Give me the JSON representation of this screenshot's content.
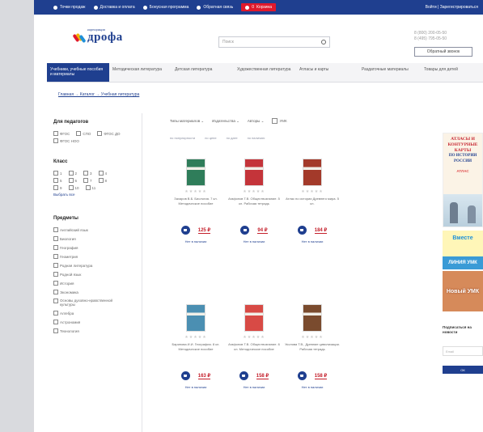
{
  "topbar": {
    "links": [
      {
        "icon": "location-icon",
        "label": "Точки продаж"
      },
      {
        "icon": "delivery-icon",
        "label": "Доставка и оплата"
      },
      {
        "icon": "program-icon",
        "label": "Бонусная программа"
      },
      {
        "icon": "feedback-icon",
        "label": "Обратная связь"
      }
    ],
    "cart_label": "Корзина",
    "cart_count": "0",
    "login_label": "Войти | Зарегистрироваться"
  },
  "header": {
    "logo_text": "дрофа",
    "logo_small": "корпорация",
    "search_placeholder": "Поиск",
    "phones": [
      "8 (800) 200-05-50",
      "8 (495) 795-05-50"
    ],
    "callback_label": "Обратный звонок"
  },
  "nav": [
    "Учебники, учебные пособия и материалы",
    "Методическая литература",
    "Детская литература",
    "Художественная литература",
    "Атласы и карты",
    "Раздаточные материалы",
    "Товары для детей"
  ],
  "breadcrumbs": "Главная → Каталог → Учебная литература",
  "sidebar": {
    "level_title": "Для педагогов",
    "levels": [
      "ФГОС",
      "СПО",
      "ФГОС ДО",
      "ФГОС НОО"
    ],
    "grades_title": "Класс",
    "grades": [
      "1",
      "2",
      "3",
      "4",
      "5",
      "6",
      "7",
      "8",
      "9",
      "10",
      "11"
    ],
    "grades_link": "Выбрать все",
    "subjects_title": "Предметы",
    "subjects": [
      "Английский язык",
      "Биология",
      "География",
      "Геометрия",
      "Родная литература",
      "Родной язык",
      "История",
      "Экономика",
      "Основы духовно-нравственной культуры",
      "Алгебра",
      "Астрономия",
      "Технология"
    ]
  },
  "filters": {
    "items": [
      "Типы материалов",
      "Издательства",
      "Авторы"
    ],
    "umk_label": "УМК"
  },
  "sorts": [
    "по популярности",
    "по цене",
    "по дате",
    "по наличию"
  ],
  "products": [
    {
      "title": "Захаров В.Б. Биология. 7 кл. Методическое пособие",
      "price": "125 ₽",
      "avail": "Нет в наличии",
      "color": "#2f7d5a"
    },
    {
      "title": "Агафонов Т.В. Обществознание. 5 кл. Рабочая тетрадь",
      "price": "94 ₽",
      "avail": "Нет в наличии",
      "color": "#c4343a"
    },
    {
      "title": "Атлас по истории Древнего мира. 5 кл.",
      "price": "184 ₽",
      "avail": "Нет в наличии",
      "color": "#a33a2a"
    },
    {
      "title": "Баринова И.И. География. 8 кл. Методическое пособие",
      "price": "163 ₽",
      "avail": "Нет в наличии",
      "color": "#4b8fb2"
    },
    {
      "title": "Агафонов Т.В. Обществознание. 6 кл. Методическое пособие",
      "price": "158 ₽",
      "avail": "Нет в наличии",
      "color": "#d84a45"
    },
    {
      "title": "Уколова Т.В., Древние цивилизации. Рабочая тетрадь",
      "price": "158 ₽",
      "avail": "Нет в наличии",
      "color": "#7a4b2e"
    }
  ],
  "stars": "★★★★★",
  "banners": {
    "atlas_title_1": "АТЛАСЫ И КОНТУРНЫЕ КАРТЫ",
    "atlas_title_2": "ПО ИСТОРИИ РОССИИ",
    "atlas_word": "АТЛАС",
    "umk_top": "Вместе",
    "umk_strip": "ЛИНИЯ УМК",
    "new_umk": "Новый УМК"
  },
  "subscribe": {
    "heading": "Подписаться на новости",
    "placeholder": "Email",
    "button": "ОК"
  }
}
